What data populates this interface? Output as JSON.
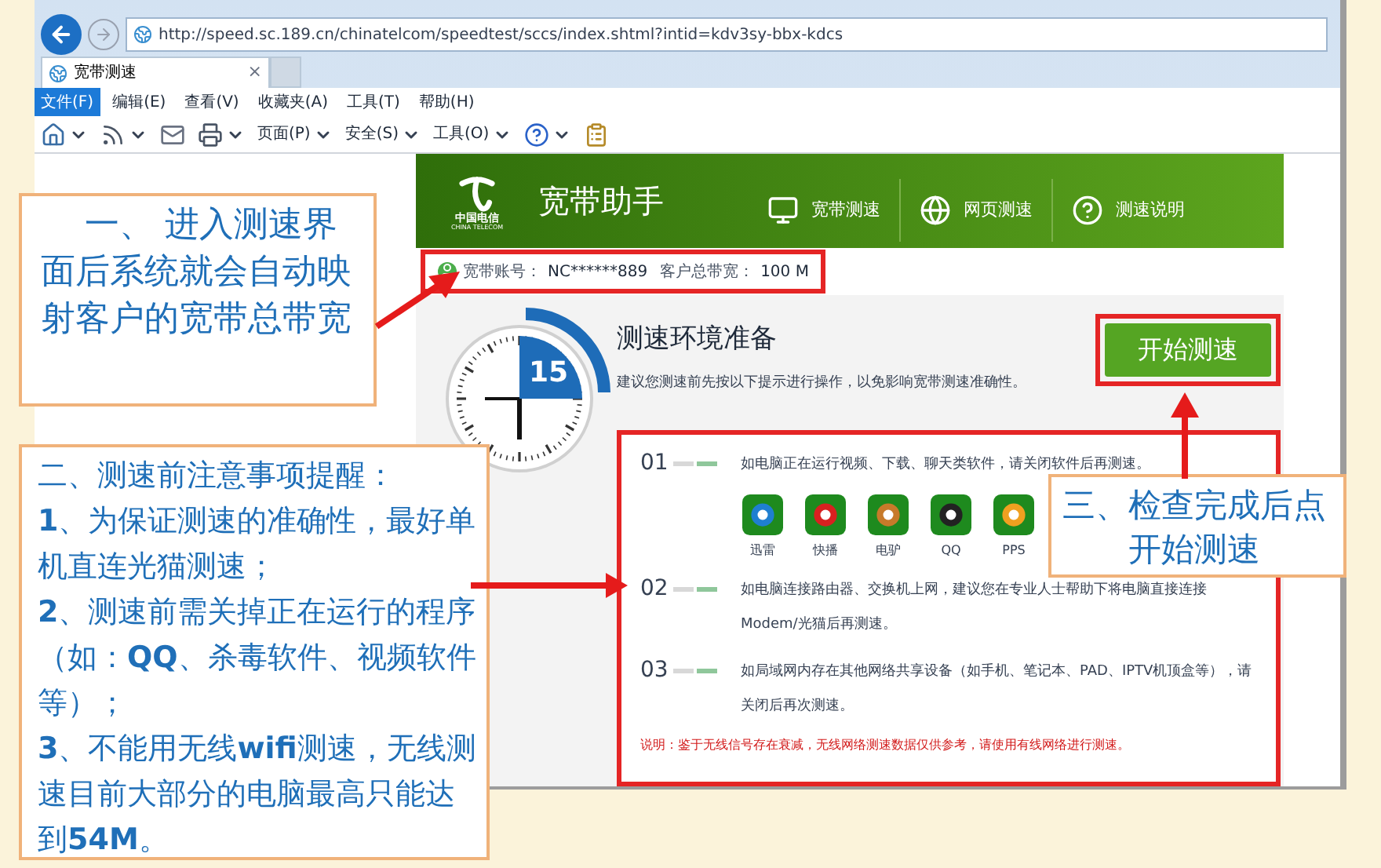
{
  "browser": {
    "address": "http://speed.sc.189.cn/chinatelcom/speedtest/sccs/index.shtml?intid=kdv3sy-bbx-kdcs",
    "tabs": [
      {
        "label": "宽带测速",
        "selected": true,
        "close": "×"
      },
      {
        "kind": "new",
        "selected": false
      }
    ],
    "menu": [
      {
        "label": "文件(F)",
        "selected": true
      },
      {
        "label": "编辑(E)",
        "selected": false
      },
      {
        "label": "查看(V)",
        "selected": false
      },
      {
        "label": "收藏夹(A)",
        "selected": false
      },
      {
        "label": "工具(T)",
        "selected": false
      },
      {
        "label": "帮助(H)",
        "selected": false
      }
    ],
    "toolbar": [
      {
        "kind": "icon",
        "dropdown": true
      },
      {
        "kind": "icon",
        "dropdown": true
      },
      {
        "kind": "icon",
        "dropdown": false
      },
      {
        "kind": "icon",
        "dropdown": true
      },
      {
        "kind": "menu",
        "label": "页面(P)",
        "dropdown": true
      },
      {
        "kind": "menu",
        "label": "安全(S)",
        "dropdown": true
      },
      {
        "kind": "menu",
        "label": "工具(O)",
        "dropdown": true
      },
      {
        "kind": "icon",
        "dropdown": true
      },
      {
        "kind": "icon",
        "dropdown": false
      }
    ]
  },
  "app": {
    "logo": {
      "name": "中国电信",
      "subtitle": "CHINA TELECOM"
    },
    "title": "宽带助手",
    "nav": [
      {
        "label": "宽带测速"
      },
      {
        "label": "网页测速"
      },
      {
        "label": "测速说明"
      }
    ],
    "account": {
      "label": "宽带账号：",
      "value": "NC******889",
      "bandwidth_label": "客户总带宽：",
      "bandwidth": "100 M"
    },
    "timer": {
      "value": "15"
    },
    "heading": "测速环境准备",
    "subtitle": "建议您测速前先按以下提示进行操作，以免影响宽带测速准确性。",
    "start_button": "开始测速",
    "steps": [
      {
        "number": "01",
        "text": "如电脑正在运行视频、下载、聊天类软件，请关闭软件后再测速。",
        "apps": [
          "迅雷",
          "快播",
          "电驴",
          "QQ",
          "PPS"
        ]
      },
      {
        "number": "02",
        "text": "如电脑连接路由器、交换机上网，建议您在专业人士帮助下将电脑直接连接Modem/光猫后再测速。"
      },
      {
        "number": "03",
        "text": "如局域网内存在其他网络共享设备（如手机、笔记本、PAD、IPTV机顶盒等），请关闭后再次测速。"
      }
    ],
    "note": "说明：鉴于无线信号存在衰减，无线网络测速数据仅供参考，请使用有线网络进行测速。"
  },
  "callouts": [
    {
      "kind": "intro",
      "lines": [
        "一、 进入测速界面后系统就会自动映射客户的宽带总带宽"
      ]
    },
    {
      "kind": "list",
      "lines": [
        "二、测速前注意事项提醒：",
        "**1**、为保证测速的准确性，最好单机直连光猫测速；",
        "**2**、测速前需关掉正在运行的程序（如：**QQ**、杀毒软件、视频软件等）；",
        "**3**、不能用无线**wifi**测速，无线测速目前大部分的电脑最高只能达到**54M**。"
      ]
    },
    {
      "kind": "action",
      "lines": [
        "三、检查完成后点开始测速"
      ]
    }
  ]
}
